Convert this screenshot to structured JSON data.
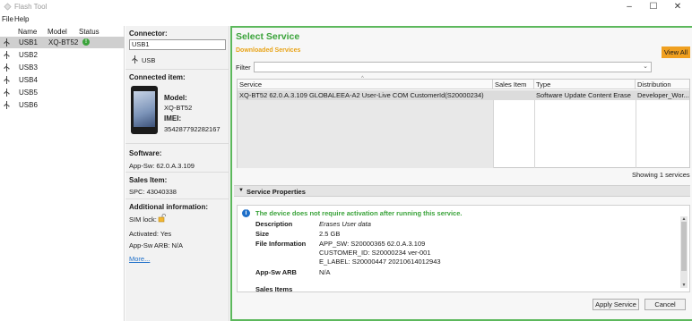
{
  "window": {
    "title": "Flash Tool",
    "controls": [
      "minimize",
      "maximize",
      "close"
    ]
  },
  "menu": {
    "items": [
      "File",
      "Help"
    ]
  },
  "device_list": {
    "headers": [
      "Name",
      "Model",
      "Status"
    ],
    "rows": [
      {
        "port": "USB1",
        "model": "XQ-BT52",
        "selected": true
      },
      {
        "port": "USB2",
        "model": ""
      },
      {
        "port": "USB3",
        "model": ""
      },
      {
        "port": "USB4",
        "model": ""
      },
      {
        "port": "USB5",
        "model": ""
      },
      {
        "port": "USB6",
        "model": ""
      }
    ]
  },
  "details": {
    "connector_label": "Connector:",
    "connector_value": "USB1",
    "connector_type": "USB",
    "connected_label": "Connected item:",
    "model_label": "Model:",
    "model_value": "XQ-BT52",
    "imei_label": "IMEI:",
    "imei_value": "354287792282167",
    "software_label": "Software:",
    "software_value": "App-Sw: 62.0.A.3.109",
    "sales_label": "Sales Item:",
    "sales_value": "SPC: 43040338",
    "additional_label": "Additional information:",
    "sim_lock": "SIM lock:",
    "activated": "Activated: Yes",
    "arb": "App-Sw ARB: N/A",
    "more": "More..."
  },
  "service": {
    "title": "Select Service",
    "subtitle": "Downloaded Services",
    "view_all": "View All",
    "filter_label": "Filter",
    "filter_value": "",
    "columns": [
      "Service",
      "Sales Item",
      "Type",
      "Distribution"
    ],
    "rows": [
      {
        "service": "XQ-BT52 62.0.A.3.109 GLOBALEEA-A2 User-Live COM CustomerId(S20000234)",
        "sales_item": "",
        "type": "Software Update Content Erase",
        "distribution": "Developer_Wor..."
      }
    ],
    "showing": "Showing 1 services",
    "properties_title": "Service Properties",
    "properties_message": "The device does not require activation after running this service.",
    "props": {
      "description_label": "Description",
      "description_value": "Erases User data",
      "size_label": "Size",
      "size_value": "2.5 GB",
      "fileinfo_label": "File Information",
      "fileinfo_line1": "APP_SW: S20000365 62.0.A.3.109",
      "fileinfo_line2": "CUSTOMER_ID: S20000234 ver-001",
      "fileinfo_line3": "E_LABEL: S20000447 20210614012943",
      "arb_label": "App-Sw ARB",
      "arb_value": "N/A",
      "sales_items_label": "Sales Items"
    },
    "apply_button": "Apply Service",
    "cancel_button": "Cancel"
  },
  "colors": {
    "accent_green": "#3aa33a",
    "accent_orange": "#f0a020",
    "selection_gray": "#cfcfcf"
  }
}
